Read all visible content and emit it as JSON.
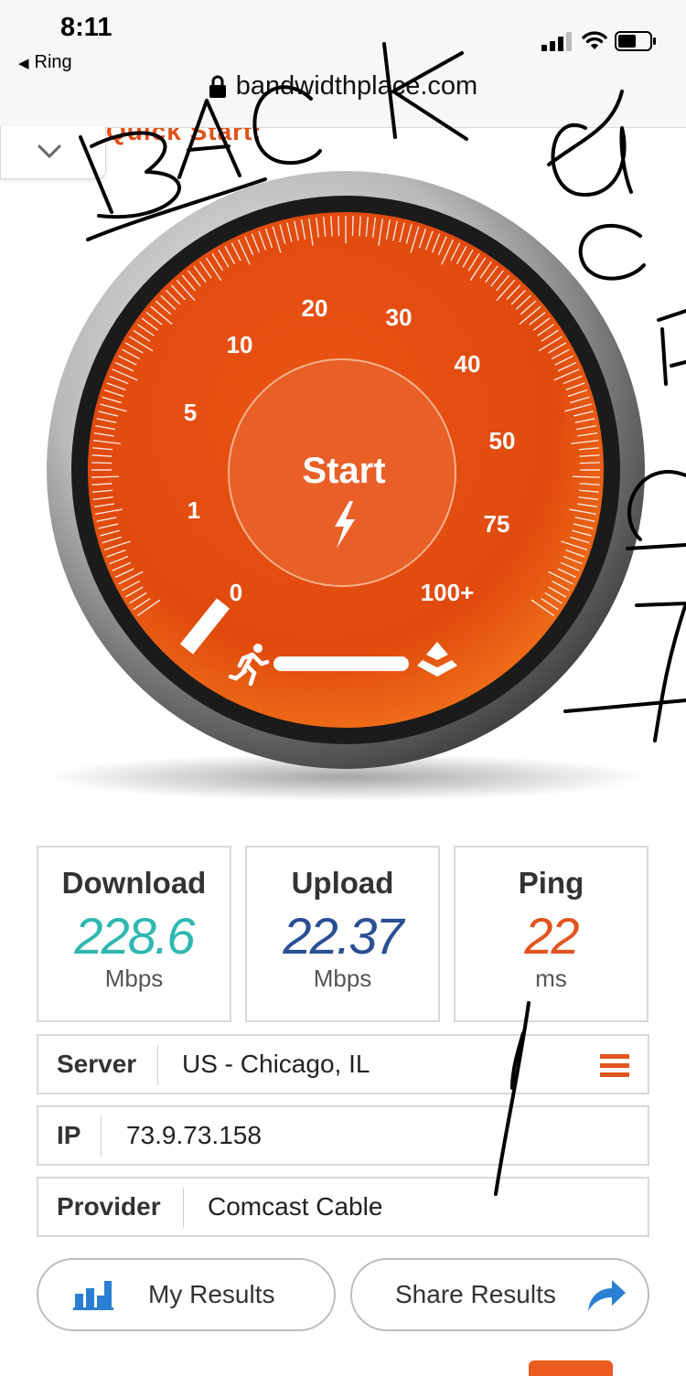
{
  "status_bar": {
    "time": "8:11",
    "back_app": "Ring",
    "url": "bandwidthplace.com"
  },
  "quick_start": {
    "label": "Quick Start:"
  },
  "gauge": {
    "center_label": "Start",
    "scale_labels": [
      "0",
      "1",
      "5",
      "10",
      "20",
      "30",
      "40",
      "50",
      "75",
      "100+"
    ],
    "colors": {
      "face": "#e84a10",
      "face_dark": "#c93b08",
      "rim": "#1b1b1b"
    }
  },
  "results": {
    "download": {
      "label": "Download",
      "value": "228.6",
      "unit": "Mbps",
      "color": "#2fb8b0"
    },
    "upload": {
      "label": "Upload",
      "value": "22.37",
      "unit": "Mbps",
      "color": "#2a4f95"
    },
    "ping": {
      "label": "Ping",
      "value": "22",
      "unit": "ms",
      "color": "#e2551f"
    }
  },
  "info": {
    "server": {
      "label": "Server",
      "value": "US - Chicago, IL"
    },
    "ip": {
      "label": "IP",
      "value": "73.9.73.158"
    },
    "provider": {
      "label": "Provider",
      "value": "Comcast Cable"
    }
  },
  "buttons": {
    "my_results": "My Results",
    "share_results": "Share Results"
  },
  "icons": {
    "lock": "lock-icon",
    "signal": "cellular-signal-icon",
    "wifi": "wifi-icon",
    "battery": "battery-icon",
    "chevron": "chevron-down-icon",
    "bolt": "lightning-icon",
    "runner": "runner-icon",
    "layers": "layers-icon",
    "menu": "hamburger-menu-icon",
    "bar_chart": "bar-chart-icon",
    "share": "share-arrow-icon"
  }
}
